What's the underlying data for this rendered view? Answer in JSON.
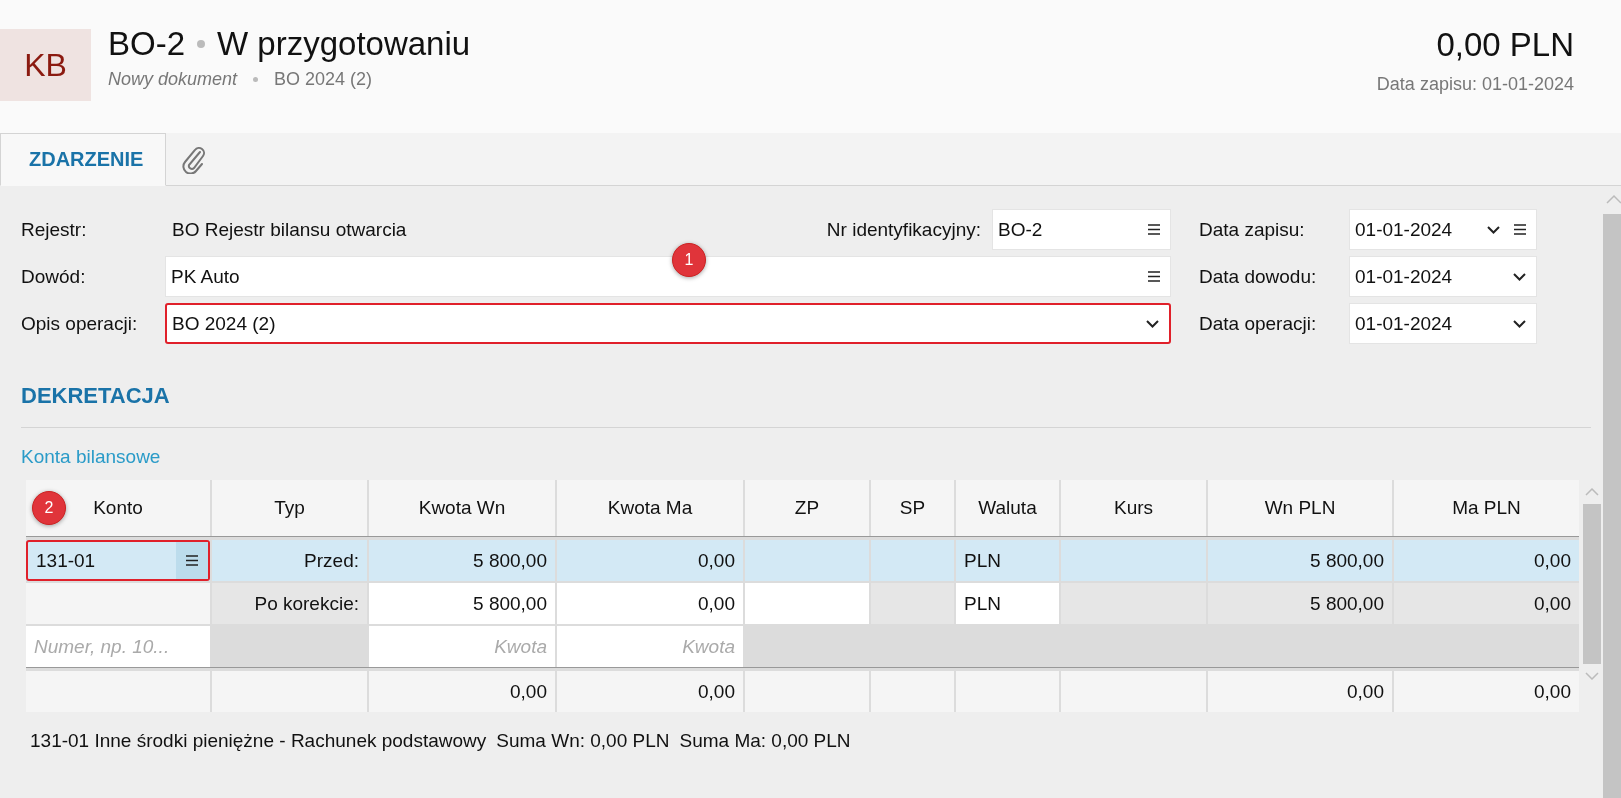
{
  "header": {
    "avatar": "KB",
    "number": "BO-2",
    "status": "W przygotowaniu",
    "subtitle": "Nowy dokument",
    "reference": "BO 2024 (2)",
    "amount": "0,00 PLN",
    "date": "Data zapisu: 01-01-2024"
  },
  "tabs": [
    {
      "kind": "text",
      "label": "ZDARZENIE",
      "selected": true
    },
    {
      "kind": "attachment",
      "selected": false
    }
  ],
  "form": {
    "rejestr": {
      "label": "Rejestr:",
      "value": "BO Rejestr bilansu otwarcia"
    },
    "nr": {
      "label": "Nr identyfikacyjny:",
      "value": "BO-2",
      "highlighted": false
    },
    "dowod": {
      "label": "Dowód:",
      "value": "PK Auto",
      "highlighted": false
    },
    "opis": {
      "label": "Opis operacji:",
      "value": "BO 2024 (2)",
      "highlighted": true
    },
    "dates": [
      {
        "label": "Data zapisu:",
        "value": "01-01-2024",
        "list_button": true
      },
      {
        "label": "Data dowodu:",
        "value": "01-01-2024",
        "list_button": false
      },
      {
        "label": "Data operacji:",
        "value": "01-01-2024",
        "list_button": false
      }
    ]
  },
  "markers": [
    {
      "label": "1"
    },
    {
      "label": "2"
    }
  ],
  "section": {
    "title": "DEKRETACJA",
    "subtitle": "Konta bilansowe"
  },
  "table": {
    "columns": [
      "Konto",
      "Typ",
      "Kwota Wn",
      "Kwota Ma",
      "ZP",
      "SP",
      "Waluta",
      "Kurs",
      "Wn PLN",
      "Ma PLN"
    ],
    "rows": [
      {
        "kind": "entry",
        "selected": true,
        "account": "131-01",
        "account_highlighted": true,
        "cells": [
          {
            "text": "Przed:"
          },
          {
            "text": "5 800,00"
          },
          {
            "text": "0,00"
          },
          {
            "text": ""
          },
          {
            "text": ""
          },
          {
            "text": "PLN"
          },
          {
            "text": ""
          },
          {
            "text": "5 800,00"
          },
          {
            "text": "0,00"
          }
        ]
      },
      {
        "kind": "entry",
        "selected": false,
        "cells": [
          {
            "text": "Po korekcie:",
            "editable": false
          },
          {
            "text": "5 800,00",
            "editable": true
          },
          {
            "text": "0,00",
            "editable": true
          },
          {
            "text": "",
            "editable": true
          },
          {
            "text": "",
            "editable": false
          },
          {
            "text": "PLN",
            "editable": true
          },
          {
            "text": "",
            "editable": false
          },
          {
            "text": "5 800,00",
            "editable": false
          },
          {
            "text": "0,00",
            "editable": false
          }
        ]
      },
      {
        "kind": "new",
        "account_placeholder": "Numer, np. 10...",
        "amount_placeholders": [
          "Kwota",
          "Kwota"
        ]
      },
      {
        "kind": "total",
        "cells": [
          "",
          "0,00",
          "0,00",
          "",
          "",
          "",
          "",
          "0,00",
          "0,00"
        ]
      }
    ]
  },
  "footer": {
    "account": "131-01 Inne środki pieniężne - Rachunek podstawowy",
    "sum_wn": "Suma Wn: 0,00 PLN",
    "sum_ma": "Suma Ma: 0,00 PLN"
  }
}
